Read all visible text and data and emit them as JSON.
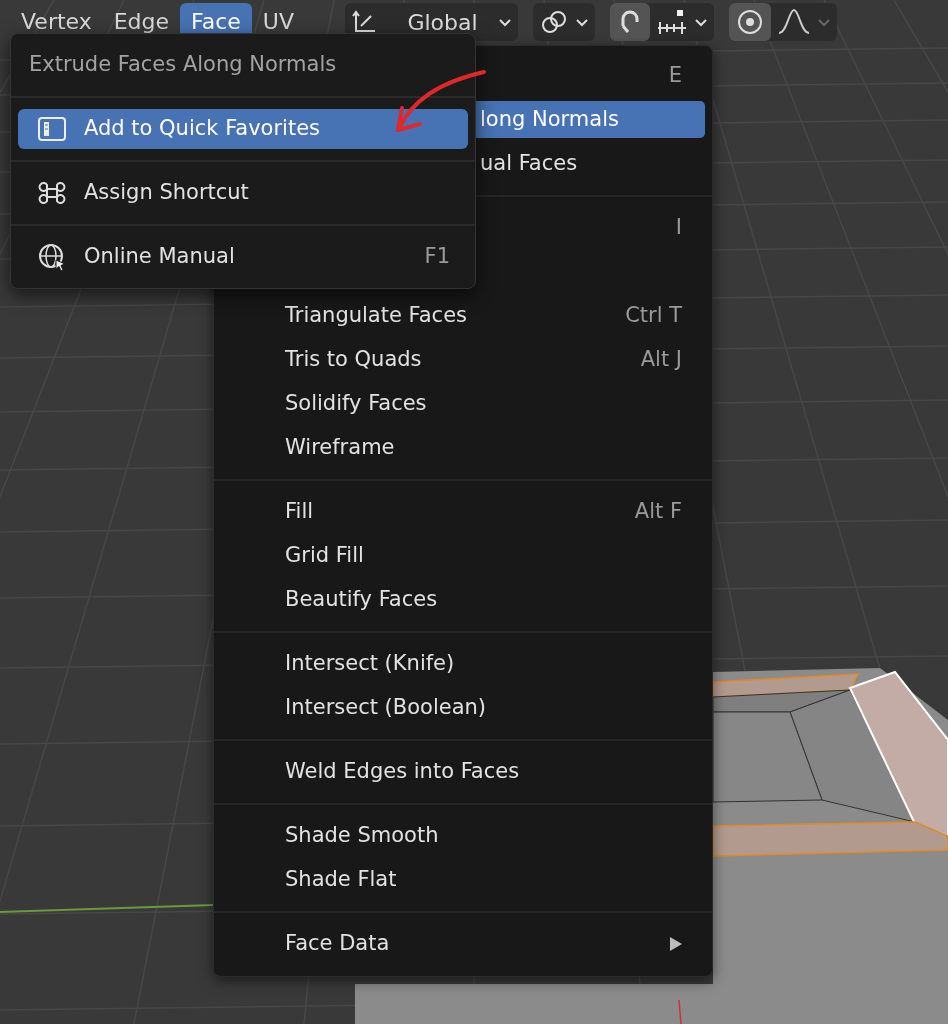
{
  "header": {
    "modes": [
      {
        "label": "Vertex",
        "selected": false
      },
      {
        "label": "Edge",
        "selected": false
      },
      {
        "label": "Face",
        "selected": true
      },
      {
        "label": "UV",
        "selected": false
      }
    ],
    "orientation": {
      "label": "Global"
    },
    "snap": {
      "on": true
    },
    "proportional": {
      "on": true
    }
  },
  "face_menu": {
    "sections": [
      {
        "items": [
          {
            "shortcut": "E",
            "selected": false
          },
          {
            "label": "long Normals",
            "selected": true
          },
          {
            "label": "ual Faces",
            "selected": false
          }
        ]
      },
      {
        "items": [
          {
            "shortcut": "I",
            "selected": false
          },
          {
            "selected": false
          },
          {
            "label": "Triangulate Faces",
            "shortcut": "Ctrl T",
            "selected": false
          },
          {
            "label": "Tris to Quads",
            "shortcut": "Alt J",
            "selected": false
          },
          {
            "label": "Solidify Faces",
            "selected": false
          },
          {
            "label": "Wireframe",
            "selected": false
          }
        ]
      },
      {
        "items": [
          {
            "label": "Fill",
            "shortcut": "Alt F",
            "selected": false
          },
          {
            "label": "Grid Fill",
            "selected": false
          },
          {
            "label": "Beautify Faces",
            "selected": false
          }
        ]
      },
      {
        "items": [
          {
            "label": "Intersect (Knife)",
            "selected": false
          },
          {
            "label": "Intersect (Boolean)",
            "selected": false
          }
        ]
      },
      {
        "items": [
          {
            "label": "Weld Edges into Faces",
            "selected": false
          }
        ]
      },
      {
        "items": [
          {
            "label": "Shade Smooth",
            "selected": false
          },
          {
            "label": "Shade Flat",
            "selected": false
          }
        ]
      },
      {
        "items": [
          {
            "label": "Face Data",
            "submenu": true,
            "selected": false
          }
        ]
      }
    ]
  },
  "context_popup": {
    "title": "Extrude Faces Along Normals",
    "items": [
      {
        "label": "Add to Quick Favorites",
        "selected": true
      },
      {
        "label": "Assign Shortcut",
        "selected": false
      },
      {
        "label": "Online Manual",
        "shortcut": "F1",
        "selected": false
      }
    ]
  }
}
